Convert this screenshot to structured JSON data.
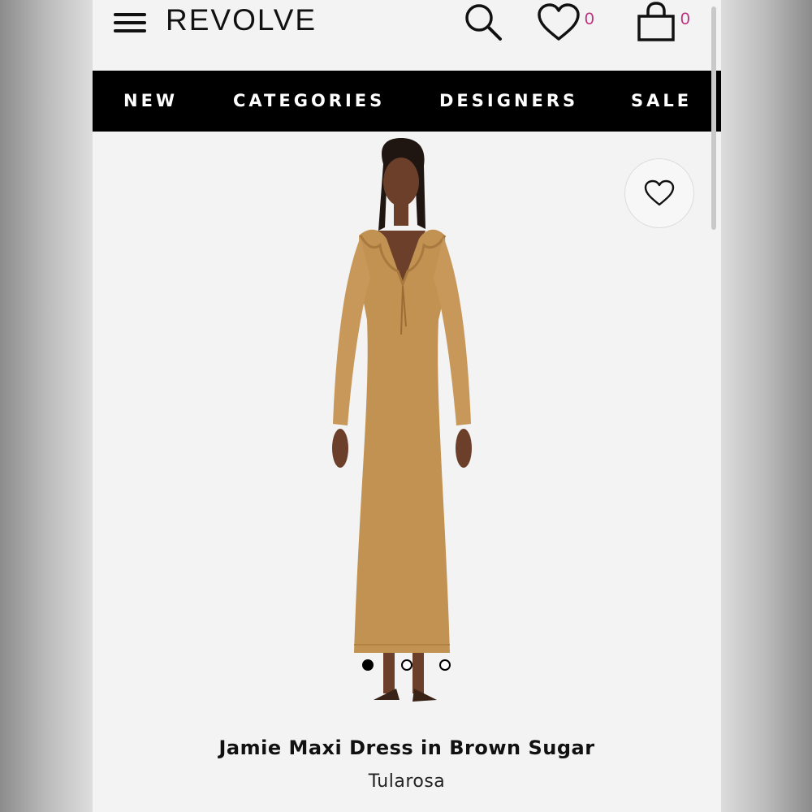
{
  "header": {
    "logo": "REVOLVE",
    "wishlist_count": "0",
    "bag_count": "0"
  },
  "nav": {
    "items": [
      "NEW",
      "CATEGORIES",
      "DESIGNERS",
      "SALE"
    ]
  },
  "product": {
    "title": "Jamie Maxi Dress in Brown Sugar",
    "brand": "Tularosa",
    "image_count": 3,
    "active_image_index": 0,
    "image_subject": "model wearing long-sleeve ruffle V-neck maxi dress"
  },
  "colors": {
    "nav_background": "#000000",
    "page_background": "#f3f3f3",
    "count_accent": "#c0307e",
    "dress_color": "#c19252"
  },
  "icons": [
    "menu-icon",
    "search-icon",
    "heart-icon",
    "bag-icon"
  ]
}
